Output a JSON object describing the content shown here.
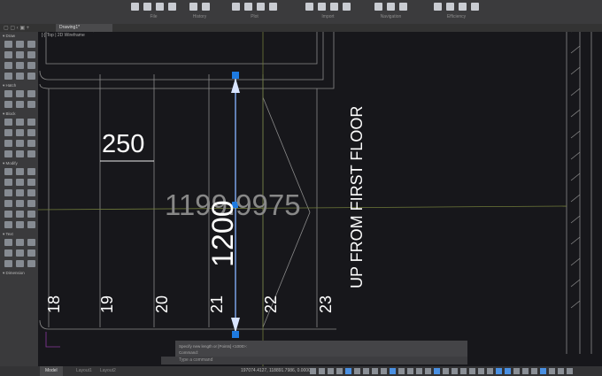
{
  "ribbon": {
    "groups": [
      {
        "label": "File",
        "icons": [
          "new-icon",
          "open-icon",
          "save-icon",
          "save-as-icon"
        ]
      },
      {
        "label": "History",
        "icons": [
          "undo-icon",
          "redo-icon"
        ]
      },
      {
        "label": "Plot",
        "icons": [
          "print-icon",
          "plot-icon",
          "page-setup-icon",
          "publish-icon"
        ]
      },
      {
        "label": "Import",
        "icons": [
          "import-icon",
          "attach-icon",
          "image-icon",
          "pdf-icon"
        ]
      },
      {
        "label": "Navigation",
        "icons": [
          "zoom-icon",
          "pan-icon",
          "orbit-icon"
        ]
      },
      {
        "label": "Efficiency",
        "icons": [
          "properties-icon",
          "match-icon",
          "purge-icon",
          "layers-icon"
        ]
      }
    ]
  },
  "document": {
    "tab": "Drawing1*",
    "viewport": "[-] Top | 2D Wireframe"
  },
  "palette": {
    "sections": [
      {
        "label": "Draw",
        "count": 12
      },
      {
        "label": "Hatch",
        "count": 6
      },
      {
        "label": "Block",
        "count": 12
      },
      {
        "label": "Modify",
        "count": 18
      },
      {
        "label": "Text",
        "count": 9
      },
      {
        "label": "Dimension",
        "count": 0
      }
    ]
  },
  "drawing": {
    "dim_width": "250",
    "dim_length": "1200",
    "dynamic_input": "1199.9975",
    "label": "UP FROM FIRST FLOOR",
    "steps": [
      "18",
      "19",
      "20",
      "21",
      "22",
      "23"
    ]
  },
  "command": {
    "history": [
      "Specify new length or [Points] <1000>:",
      "Command:"
    ],
    "placeholder": "Type a command"
  },
  "status": {
    "tabs": [
      "Model",
      "Layout1",
      "Layout2"
    ],
    "coordinates": "197074.4127, 118891.7986, 0.0000"
  }
}
